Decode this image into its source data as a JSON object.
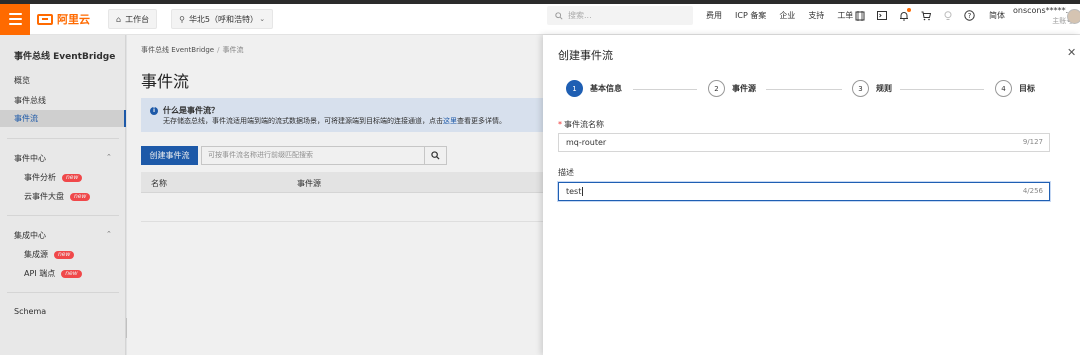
{
  "header": {
    "logo_text": "阿里云",
    "workbench_label": "工作台",
    "region_label": "华北5（呼和浩特）",
    "search_placeholder": "搜索...",
    "nav_links": [
      "费用",
      "ICP 备案",
      "企业",
      "支持",
      "工单"
    ],
    "lang_label": "简体",
    "user_name": "onscons*****...",
    "user_role": "主账号",
    "accent_color": "#ff6a00"
  },
  "sidebar": {
    "title": "事件总线 EventBridge",
    "items": [
      "概览",
      "事件总线",
      "事件流"
    ],
    "active_item": "事件流",
    "group1": {
      "label": "事件中心",
      "items": [
        {
          "label": "事件分析",
          "badge": "new"
        },
        {
          "label": "云事件大盘",
          "badge": "new"
        }
      ]
    },
    "group2": {
      "label": "集成中心",
      "items": [
        {
          "label": "集成源",
          "badge": "new"
        },
        {
          "label": "API 端点",
          "badge": "new"
        }
      ]
    },
    "schema_label": "Schema"
  },
  "main": {
    "breadcrumb": [
      "事件总线 EventBridge",
      "事件流"
    ],
    "title": "事件流",
    "info_title": "什么是事件流？",
    "info_body": "无存储态总线，事件流适用端到端的流式数据场景，可将建源端到目标端的连接通道，点击",
    "info_link": "这里",
    "info_tail": "查看更多详情。",
    "create_button": "创建事件流",
    "list_search_placeholder": "可按事件流名称进行前缀匹配搜索",
    "columns": [
      "名称",
      "事件源"
    ]
  },
  "drawer": {
    "title": "创建事件流",
    "steps": [
      {
        "num": "1",
        "label": "基本信息",
        "active": true
      },
      {
        "num": "2",
        "label": "事件源",
        "active": false
      },
      {
        "num": "3",
        "label": "规则",
        "active": false
      },
      {
        "num": "4",
        "label": "目标",
        "active": false
      }
    ],
    "name_label": "事件流名称",
    "name_value": "mq-router",
    "name_count": "9/127",
    "desc_label": "描述",
    "desc_value": "test",
    "desc_count": "4/256",
    "primary_color": "#1f5fb3"
  }
}
